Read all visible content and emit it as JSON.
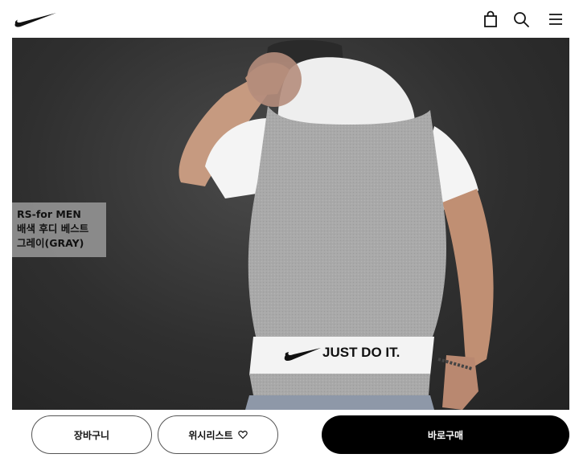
{
  "header": {
    "logo": "nike-swoosh-logo",
    "icons": [
      "bag-icon",
      "search-icon",
      "menu-icon"
    ]
  },
  "product_image": {
    "print_text": "JUST DO IT.",
    "caption_lines": [
      "RS-for MEN",
      "배색 후디 베스트",
      "그레이(GRAY)"
    ]
  },
  "actions": {
    "cart_label": "장바구니",
    "wishlist_label": "위시리스트",
    "buy_label": "바로구매"
  },
  "colors": {
    "buy_button": "#000000",
    "background": "#ffffff"
  }
}
